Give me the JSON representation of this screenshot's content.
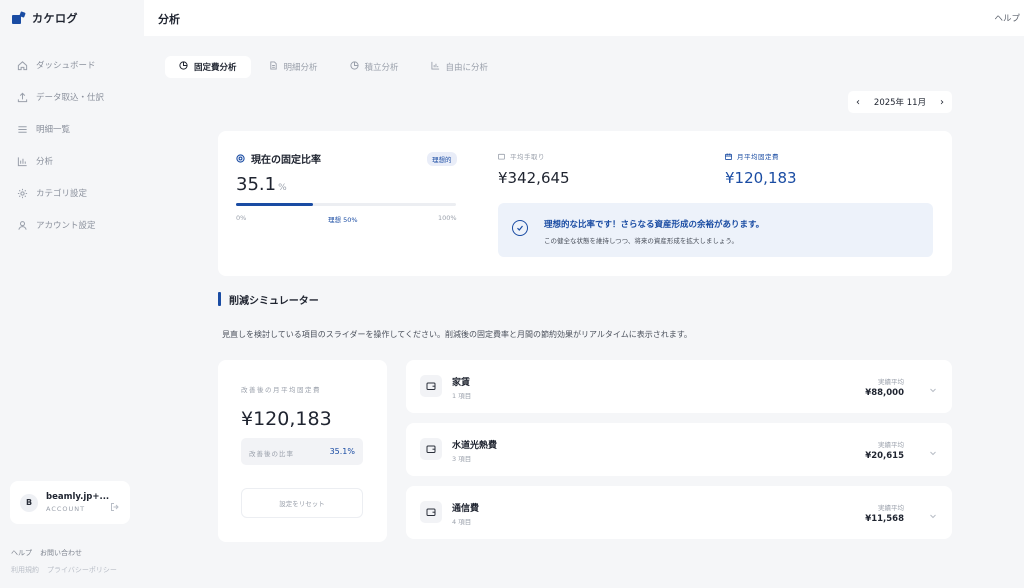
{
  "app": {
    "name": "カケログ"
  },
  "sidebar": {
    "items": [
      {
        "label": "ダッシュボード",
        "icon": "home-icon"
      },
      {
        "label": "データ取込・仕訳",
        "icon": "upload-icon"
      },
      {
        "label": "明細一覧",
        "icon": "list-icon"
      },
      {
        "label": "分析",
        "icon": "bar-chart-icon"
      },
      {
        "label": "カテゴリ設定",
        "icon": "gear-icon"
      },
      {
        "label": "アカウント設定",
        "icon": "user-icon"
      }
    ],
    "account": {
      "initial": "B",
      "name": "beamly.jp+...",
      "sub": "ACCOUNT"
    },
    "footer": {
      "help": "ヘルプ",
      "contact": "お問い合わせ",
      "terms": "利用規約",
      "privacy": "プライバシーポリシー"
    }
  },
  "header": {
    "title": "分析",
    "help": "ヘルプ"
  },
  "tabs": [
    {
      "label": "固定費分析",
      "active": true
    },
    {
      "label": "明細分析",
      "active": false
    },
    {
      "label": "積立分析",
      "active": false
    },
    {
      "label": "自由に分析",
      "active": false
    }
  ],
  "month": {
    "label": "2025年 11月",
    "prev": "‹",
    "next": "›"
  },
  "summary": {
    "ratio_title": "現在の固定比率",
    "badge": "理想的",
    "ratio_value": "35.1",
    "ratio_unit": "%",
    "ratio_fraction": 0.351,
    "bar_min": "0%",
    "bar_ideal": "理想 50%",
    "bar_max": "100%",
    "income_label": "平均手取り",
    "income_value": "¥342,645",
    "fixed_label": "月平均固定費",
    "fixed_value": "¥120,183",
    "advice_title": "理想的な比率です！さらなる資産形成の余裕があります。",
    "advice_sub": "この健全な状態を維持しつつ、将来の資産形成を拡大しましょう。"
  },
  "simulator": {
    "title": "削減シミュレーター",
    "description": "見直しを検討している項目のスライダーを操作してください。削減後の固定費率と月間の節約効果がリアルタイムに表示されます。",
    "card_label": "改善後の月平均固定費",
    "card_value": "¥120,183",
    "ratio_label": "改善後の比率",
    "ratio_value": "35.1%",
    "reset_label": "設定をリセット"
  },
  "expenses": [
    {
      "name": "家賃",
      "count": "1 項目",
      "avg_label": "実績平均",
      "avg_value": "¥88,000"
    },
    {
      "name": "水道光熱費",
      "count": "3 項目",
      "avg_label": "実績平均",
      "avg_value": "¥20,615"
    },
    {
      "name": "通信費",
      "count": "4 項目",
      "avg_label": "実績平均",
      "avg_value": "¥11,568"
    }
  ],
  "colors": {
    "accent": "#1a4ca3",
    "background": "#f5f6f8",
    "card": "#ffffff"
  }
}
